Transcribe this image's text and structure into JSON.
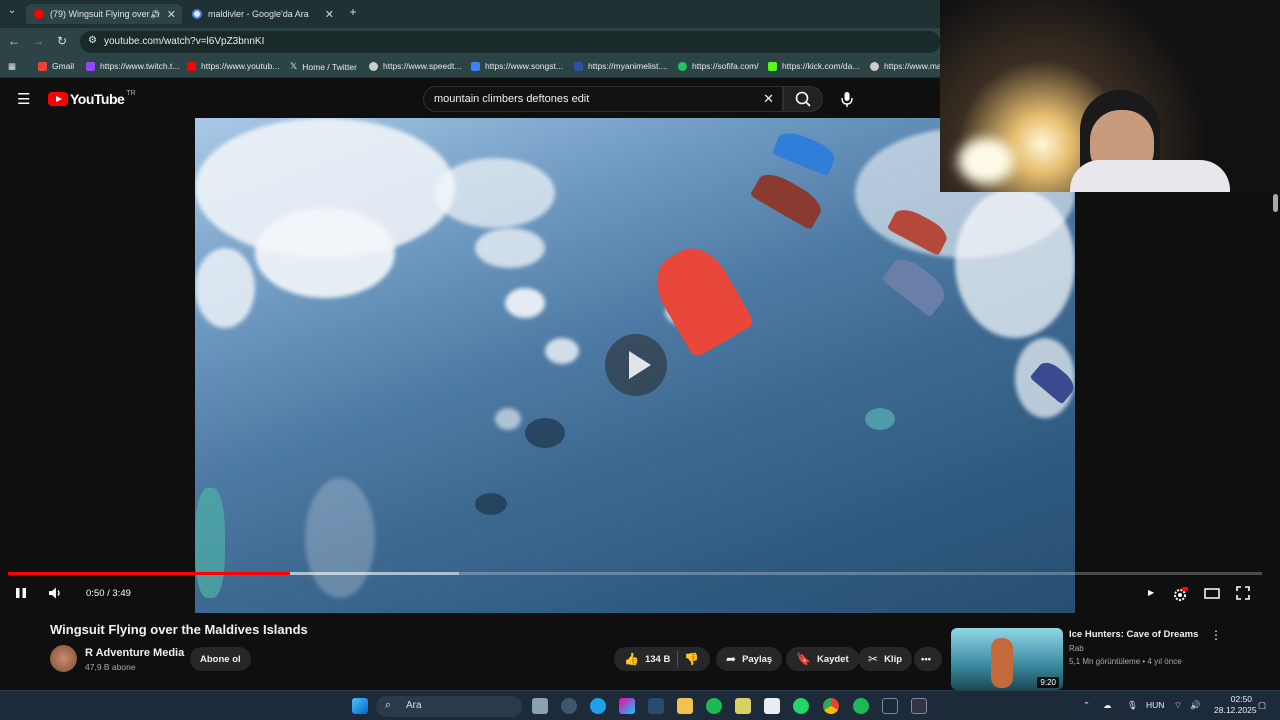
{
  "browser": {
    "tabs": [
      {
        "title": "(79) Wingsuit Flying over th",
        "active": true
      },
      {
        "title": "maldivler - Google'da Ara",
        "active": false
      }
    ],
    "url": "youtube.com/watch?v=l6VpZ3bnnKI",
    "bookmarks": [
      {
        "label": "Gmail",
        "color": "#ea4335"
      },
      {
        "label": "https://www.twitch.t...",
        "color": "#9146ff"
      },
      {
        "label": "https://www.youtub...",
        "color": "#ff0000"
      },
      {
        "label": "Home / Twitter",
        "color": "#ffffff"
      },
      {
        "label": "https://www.speedt...",
        "color": "#cccccc"
      },
      {
        "label": "https://www.songst...",
        "color": "#3b82f6"
      },
      {
        "label": "https://myanimelist....",
        "color": "#2e51a2"
      },
      {
        "label": "https://sofifa.com/",
        "color": "#22c55e"
      },
      {
        "label": "https://kick.com/da...",
        "color": "#53fc18"
      },
      {
        "label": "https://www.ma",
        "color": "#cccccc"
      }
    ]
  },
  "youtube": {
    "logo_text": "YouTube",
    "region": "TR",
    "search_value": "mountain climbers deftones edit"
  },
  "player": {
    "current_time": "0:50",
    "duration": "3:49",
    "time_display": "0:50 / 3:49",
    "progress_fraction": 0.2245,
    "buffered_fraction": 0.36,
    "accent": "#ff0000"
  },
  "video": {
    "title": "Wingsuit Flying over the Maldives Islands",
    "channel": "R Adventure Media",
    "subscribers": "47,9 B abone",
    "subscribe_label": "Abone ol",
    "likes": "134 B",
    "share_label": "Paylaş",
    "save_label": "Kaydet",
    "clip_label": "Klip"
  },
  "recommendation": {
    "title": "Ice Hunters: Cave of Dreams",
    "channel": "Rab",
    "meta": "5,1 Mn görüntüleme • 4 yıl önce",
    "duration": "9:20"
  },
  "taskbar": {
    "search_placeholder": "Ara",
    "language": "HUN",
    "time": "02:50",
    "date": "28.12.2025"
  }
}
